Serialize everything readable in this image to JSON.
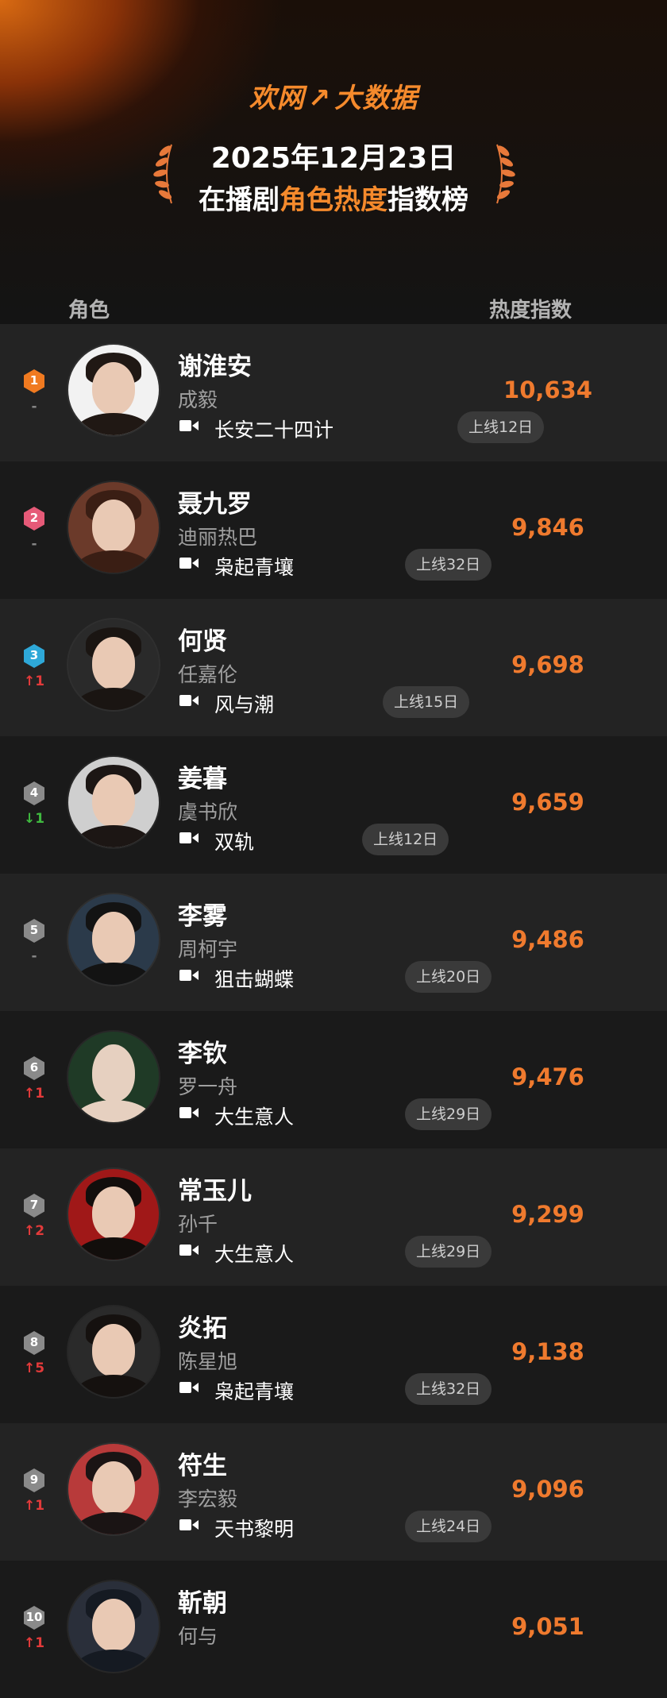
{
  "header": {
    "logo": "欢网",
    "logo_suffix": "大数据",
    "date": "2025年12月23日",
    "title_pre": "在播剧",
    "title_highlight": "角色热度",
    "title_post": "指数榜",
    "accent_color": "#f58a2c"
  },
  "columns": {
    "role": "角色",
    "index": "热度指数"
  },
  "rows": [
    {
      "rank": "1",
      "badge_color": "#f07a20",
      "change": "-",
      "change_type": "same",
      "character": "谢淮安",
      "actor": "成毅",
      "drama": "长安二十四计",
      "tag": "上线12日",
      "score": "10,634"
    },
    {
      "rank": "2",
      "badge_color": "#e65a78",
      "change": "-",
      "change_type": "same",
      "character": "聂九罗",
      "actor": "迪丽热巴",
      "drama": "枭起青壤",
      "tag": "上线32日",
      "score": "9,846"
    },
    {
      "rank": "3",
      "badge_color": "#2ea8d8",
      "change": "↑1",
      "change_type": "up",
      "character": "何贤",
      "actor": "任嘉伦",
      "drama": "风与潮",
      "tag": "上线15日",
      "score": "9,698"
    },
    {
      "rank": "4",
      "badge_color": "#8a8a8a",
      "change": "↓1",
      "change_type": "down",
      "character": "姜暮",
      "actor": "虞书欣",
      "drama": "双轨",
      "tag": "上线12日",
      "score": "9,659"
    },
    {
      "rank": "5",
      "badge_color": "#8a8a8a",
      "change": "-",
      "change_type": "same",
      "character": "李雾",
      "actor": "周柯宇",
      "drama": "狙击蝴蝶",
      "tag": "上线20日",
      "score": "9,486"
    },
    {
      "rank": "6",
      "badge_color": "#8a8a8a",
      "change": "↑1",
      "change_type": "up",
      "character": "李钦",
      "actor": "罗一舟",
      "drama": "大生意人",
      "tag": "上线29日",
      "score": "9,476"
    },
    {
      "rank": "7",
      "badge_color": "#8a8a8a",
      "change": "↑2",
      "change_type": "up",
      "character": "常玉儿",
      "actor": "孙千",
      "drama": "大生意人",
      "tag": "上线29日",
      "score": "9,299"
    },
    {
      "rank": "8",
      "badge_color": "#8a8a8a",
      "change": "↑5",
      "change_type": "up",
      "character": "炎拓",
      "actor": "陈星旭",
      "drama": "枭起青壤",
      "tag": "上线32日",
      "score": "9,138"
    },
    {
      "rank": "9",
      "badge_color": "#8a8a8a",
      "change": "↑1",
      "change_type": "up",
      "character": "符生",
      "actor": "李宏毅",
      "drama": "天书黎明",
      "tag": "上线24日",
      "score": "9,096"
    },
    {
      "rank": "10",
      "badge_color": "#8a8a8a",
      "change": "↑1",
      "change_type": "up",
      "character": "靳朝",
      "actor": "何与",
      "drama": "",
      "tag": "",
      "score": "9,051"
    }
  ]
}
